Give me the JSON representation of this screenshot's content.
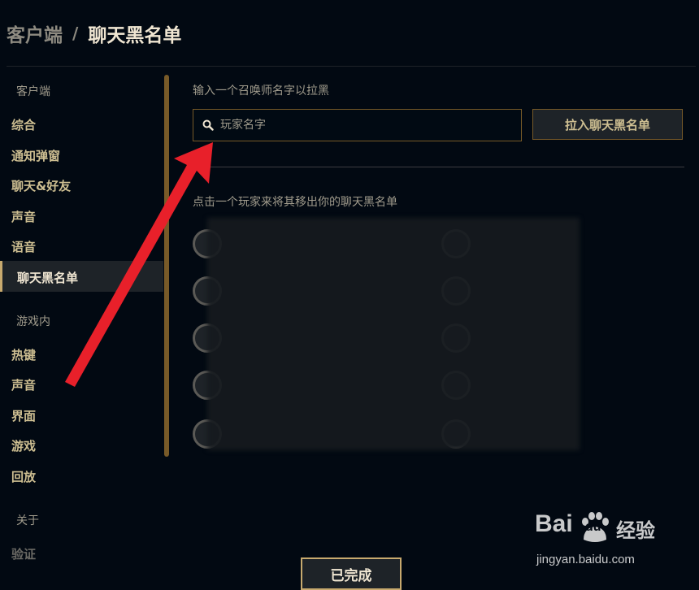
{
  "header": {
    "breadcrumb_root": "客户端",
    "separator": "/",
    "title": "聊天黑名单"
  },
  "sidebar": {
    "sections": [
      {
        "title": "客户端",
        "items": [
          "综合",
          "通知弹窗",
          "聊天&好友",
          "声音",
          "语音",
          "聊天黑名单"
        ]
      },
      {
        "title": "游戏内",
        "items": [
          "热键",
          "声音",
          "界面",
          "游戏",
          "回放"
        ]
      },
      {
        "title": "关于",
        "items": [
          "验证"
        ]
      }
    ],
    "active_item": "聊天黑名单"
  },
  "main": {
    "add_label": "输入一个召唤师名字以拉黑",
    "search_placeholder": "玩家名字",
    "add_button": "拉入聊天黑名单",
    "remove_label": "点击一个玩家来将其移出你的聊天黑名单"
  },
  "footer": {
    "done_button": "已完成"
  },
  "watermark": {
    "logo_left": "Bai",
    "logo_du": "du",
    "logo_cn": "经验",
    "url": "jingyan.baidu.com"
  },
  "colors": {
    "background": "#020912",
    "gold": "#c8aa6e",
    "gold_dark": "#785a28",
    "text_light": "#f0e6d2",
    "text_muted": "#a09b8c",
    "annotation_arrow": "#e8202a"
  }
}
